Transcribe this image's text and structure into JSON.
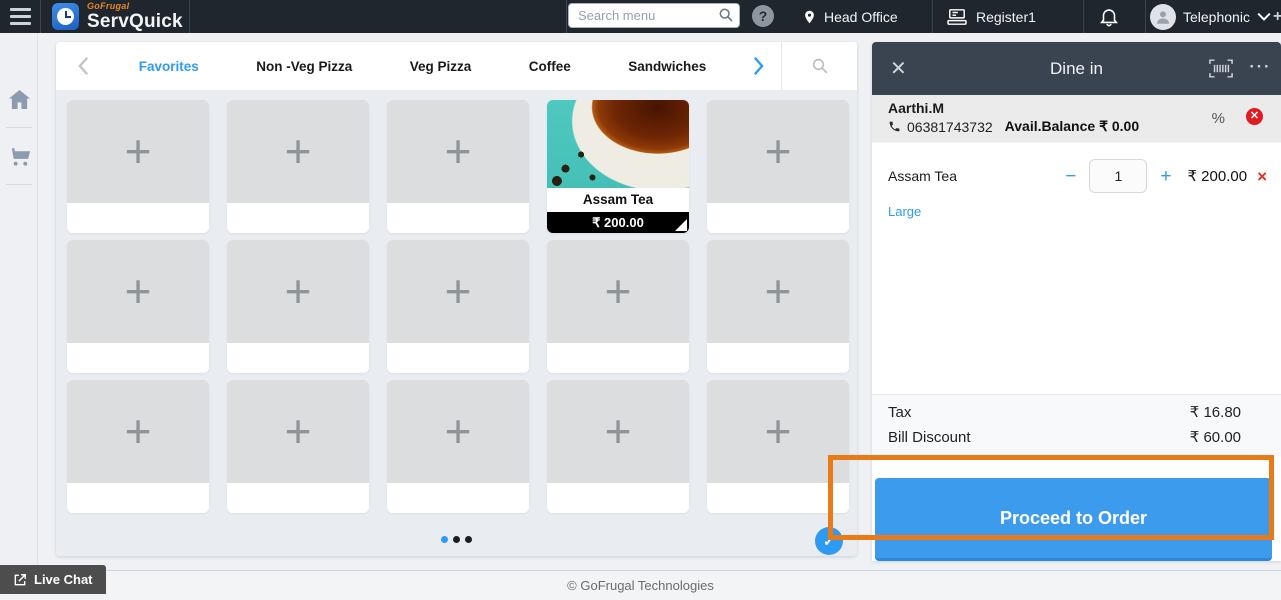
{
  "topbar": {
    "brand_top": "GoFrugal",
    "brand_bottom": "ServQuick",
    "search_placeholder": "Search menu",
    "location_label": "Head Office",
    "register_label": "Register1",
    "user_label": "Telephonic"
  },
  "tabs": {
    "items": [
      {
        "label": "Favorites",
        "active": true
      },
      {
        "label": "Non -Veg Pizza",
        "active": false
      },
      {
        "label": "Veg Pizza",
        "active": false
      },
      {
        "label": "Coffee",
        "active": false
      },
      {
        "label": "Sandwiches",
        "active": false
      }
    ]
  },
  "catalog": {
    "product": {
      "name": "Assam Tea",
      "price": "₹ 200.00"
    },
    "placeholder_glyph": "+",
    "pagination": {
      "dots": 3,
      "active_dot": 1
    }
  },
  "order_panel": {
    "title": "Dine in",
    "customer": {
      "name": "Aarthi.M",
      "phone": "06381743732",
      "balance_text": "Avail.Balance ₹ 0.00",
      "percent_glyph": "%"
    },
    "item": {
      "name": "Assam Tea",
      "variant": "Large",
      "qty": "1",
      "price": "₹ 200.00",
      "minus_glyph": "−",
      "plus_glyph": "+",
      "remove_glyph": "×"
    },
    "summary": [
      {
        "label": "Tax",
        "value": "₹ 16.80"
      },
      {
        "label": "Bill Discount",
        "value": "₹ 60.00"
      }
    ],
    "proceed_label": "Proceed to Order"
  },
  "glyphs": {
    "help": "?",
    "close": "✕",
    "more": "⋯",
    "check": "✓"
  },
  "footer": {
    "copyright": "© GoFrugal Technologies",
    "live_chat_label": "Live Chat"
  },
  "colors": {
    "accent_blue": "#2f9bf0",
    "button_blue": "#3d9bed",
    "highlight_orange": "#e87b17",
    "danger_red": "#e21b22",
    "topbar_dark": "#20262e",
    "panel_header_dark": "#3a4450"
  }
}
